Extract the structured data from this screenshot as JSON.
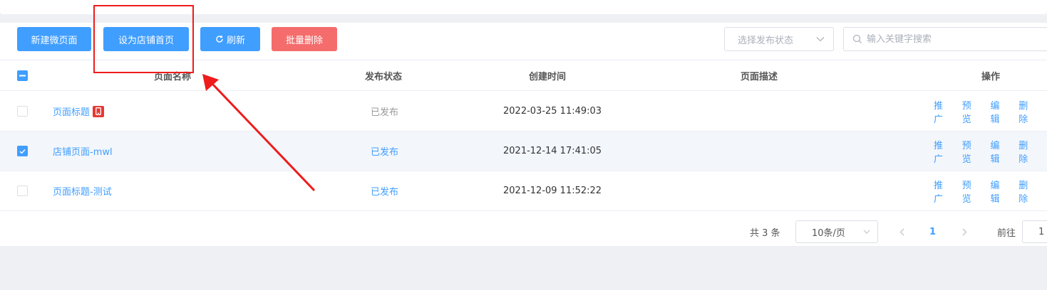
{
  "toolbar": {
    "new_page_label": "新建微页面",
    "set_home_label": "设为店铺首页",
    "refresh_label": "刷新",
    "batch_delete_label": "批量删除"
  },
  "filter": {
    "status_placeholder": "选择发布状态",
    "search_placeholder": "输入关键字搜索"
  },
  "table": {
    "columns": {
      "name": "页面名称",
      "status": "发布状态",
      "created": "创建时间",
      "desc": "页面描述",
      "actions": "操作"
    },
    "rows": [
      {
        "name": "页面标题",
        "status": "已发布",
        "created": "2022-03-25 11:49:03",
        "desc": "",
        "selected": false,
        "status_muted": true,
        "has_home_icon": true
      },
      {
        "name": "店铺页面-mwl",
        "status": "已发布",
        "created": "2021-12-14 17:41:05",
        "desc": "",
        "selected": true,
        "status_muted": false,
        "has_home_icon": false
      },
      {
        "name": "页面标题-测试",
        "status": "已发布",
        "created": "2021-12-09 11:52:22",
        "desc": "",
        "selected": false,
        "status_muted": false,
        "has_home_icon": false
      }
    ],
    "actions": {
      "promote": "推广",
      "preview": "预览",
      "edit": "编辑",
      "delete": "删除"
    }
  },
  "pagination": {
    "total": "共 3 条",
    "page_size": "10条/页",
    "current_page": "1",
    "goto_label": "前往",
    "goto_value": "1"
  },
  "colors": {
    "primary": "#409eff",
    "danger": "#f56c6c",
    "annotation": "#ee1c1c"
  }
}
